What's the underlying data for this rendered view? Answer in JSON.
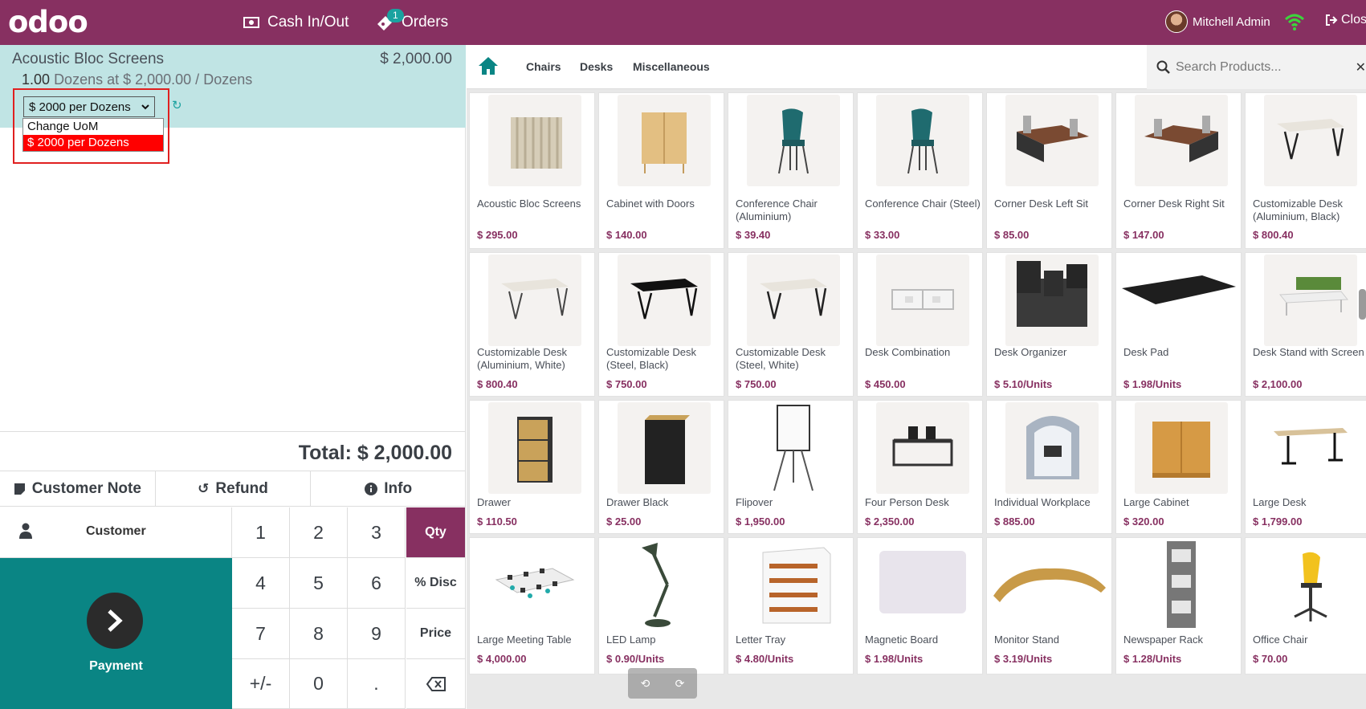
{
  "topbar": {
    "logo": "odoo",
    "cash_label": "Cash In/Out",
    "orders_label": "Orders",
    "orders_badge": "1",
    "user_name": "Mitchell Admin",
    "close_label": "Close",
    "brand_color": "#873061"
  },
  "order": {
    "line": {
      "product": "Acoustic Bloc Screens",
      "price": "$ 2,000.00",
      "qty": "1.00",
      "detail": "Dozens at $ 2,000.00 / Dozens"
    },
    "uom_select": {
      "value": "$ 2000 per Dozens",
      "options": [
        "Change UoM",
        "$ 2000 per Dozens"
      ]
    },
    "total": "Total: $ 2,000.00"
  },
  "actions": {
    "customer_note": "Customer Note",
    "refund": "Refund",
    "info": "Info"
  },
  "keypad": {
    "customer": "Customer",
    "payment": "Payment",
    "keys": [
      "1",
      "2",
      "3",
      "4",
      "5",
      "6",
      "7",
      "8",
      "9",
      "+/-",
      "0",
      "."
    ],
    "modes": [
      "Qty",
      "% Disc",
      "Price"
    ],
    "active_mode": "Qty",
    "accent": "#0a8584"
  },
  "categories": [
    "Chairs",
    "Desks",
    "Miscellaneous"
  ],
  "search": {
    "placeholder": "Search Products..."
  },
  "products": [
    {
      "name": "Acoustic Bloc Screens",
      "price": "$ 295.00"
    },
    {
      "name": "Cabinet with Doors",
      "price": "$ 140.00"
    },
    {
      "name": "Conference Chair (Aluminium)",
      "price": "$ 39.40"
    },
    {
      "name": "Conference Chair (Steel)",
      "price": "$ 33.00"
    },
    {
      "name": "Corner Desk Left Sit",
      "price": "$ 85.00"
    },
    {
      "name": "Corner Desk Right Sit",
      "price": "$ 147.00"
    },
    {
      "name": "Customizable Desk (Aluminium, Black)",
      "price": "$ 800.40"
    },
    {
      "name": "Customizable Desk (Aluminium, White)",
      "price": "$ 800.40"
    },
    {
      "name": "Customizable Desk (Steel, Black)",
      "price": "$ 750.00"
    },
    {
      "name": "Customizable Desk (Steel, White)",
      "price": "$ 750.00"
    },
    {
      "name": "Desk Combination",
      "price": "$ 450.00"
    },
    {
      "name": "Desk Organizer",
      "price": "$ 5.10/Units"
    },
    {
      "name": "Desk Pad",
      "price": "$ 1.98/Units"
    },
    {
      "name": "Desk Stand with Screen",
      "price": "$ 2,100.00"
    },
    {
      "name": "Drawer",
      "price": "$ 110.50"
    },
    {
      "name": "Drawer Black",
      "price": "$ 25.00"
    },
    {
      "name": "Flipover",
      "price": "$ 1,950.00"
    },
    {
      "name": "Four Person Desk",
      "price": "$ 2,350.00"
    },
    {
      "name": "Individual Workplace",
      "price": "$ 885.00"
    },
    {
      "name": "Large Cabinet",
      "price": "$ 320.00"
    },
    {
      "name": "Large Desk",
      "price": "$ 1,799.00"
    },
    {
      "name": "Large Meeting Table",
      "price": "$ 4,000.00"
    },
    {
      "name": "LED Lamp",
      "price": "$ 0.90/Units"
    },
    {
      "name": "Letter Tray",
      "price": "$ 4.80/Units"
    },
    {
      "name": "Magnetic Board",
      "price": "$ 1.98/Units"
    },
    {
      "name": "Monitor Stand",
      "price": "$ 3.19/Units"
    },
    {
      "name": "Newspaper Rack",
      "price": "$ 1.28/Units"
    },
    {
      "name": "Office Chair",
      "price": "$ 70.00"
    }
  ]
}
